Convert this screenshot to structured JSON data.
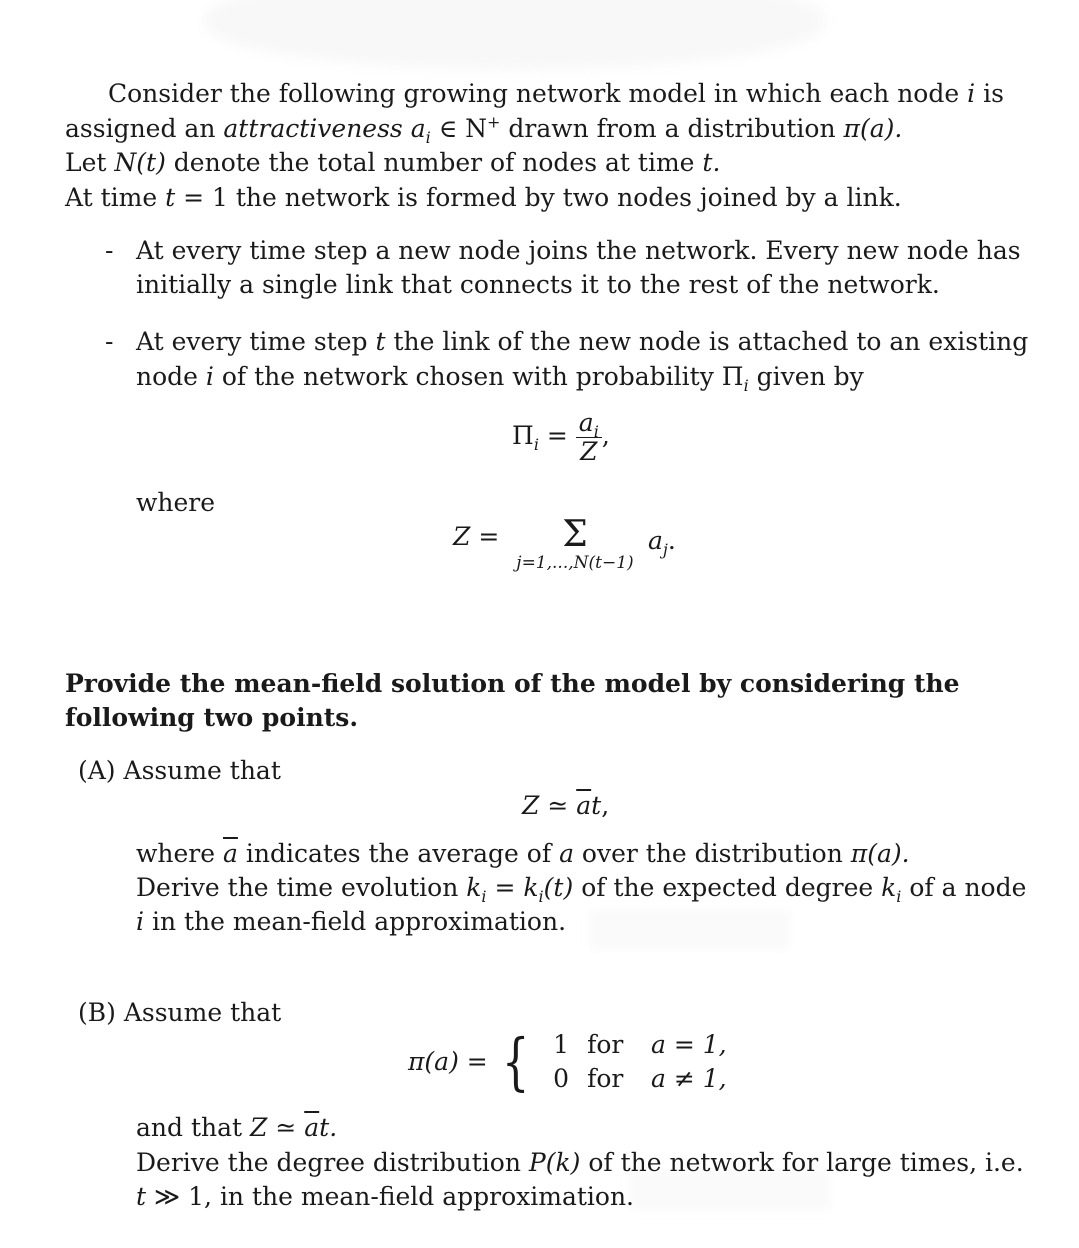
{
  "intro": {
    "line1": "Consider the following growing network model in which each node",
    "line1_var": "i",
    "line1_end": "is",
    "line2_start": "assigned an",
    "line2_em": "attractiveness",
    "line2_math": "a",
    "line2_math_sub": "i",
    "line2_in": "∈ N",
    "line2_sup": "+",
    "line2_end": "drawn from a distribution",
    "line2_pi": "π(a).",
    "line3_start": "Let",
    "line3_math": "N(t)",
    "line3_end": "denote the total number of nodes at time",
    "line3_t": "t.",
    "line4_start": "At time",
    "line4_math": "t",
    "line4_end": "= 1 the network is formed by two nodes joined by a link."
  },
  "bullets": [
    {
      "marker": "-",
      "line1": "At every time step a new node joins the network. Every new node has",
      "line2": "initially a single link that connects it to the rest of the network."
    },
    {
      "marker": "-",
      "line1_start": "At every time step",
      "line1_var": "t",
      "line1_end": "the link of the new node is attached to an existing",
      "line2_start": "node",
      "line2_var": "i",
      "line2_mid": "of the network chosen with probability Π",
      "line2_sub": "i",
      "line2_end": "given by"
    }
  ],
  "eq1": {
    "lhs": "Π",
    "lhs_sub": "i",
    "eq": "=",
    "num": "a",
    "num_sub": "i",
    "den": "Z",
    "trail": ","
  },
  "where_label": "where",
  "eq2": {
    "lhs": "Z",
    "eq": "=",
    "sigma": "Σ",
    "limits": "j=1,...,N(t−1)",
    "term": "a",
    "term_sub": "j",
    "trail": "."
  },
  "task": {
    "line1": "Provide the mean-field solution of the model by considering the",
    "line2": "following two points."
  },
  "partA": {
    "label": "(A)",
    "intro": "Assume that",
    "eq": {
      "lhs": "Z",
      "rel": "≃",
      "abar": "a",
      "t": "t",
      "trail": ","
    },
    "line1_start": "where",
    "line1_abar": "a",
    "line1_mid": "indicates the average of",
    "line1_a": "a",
    "line1_end": "over the distribution",
    "line1_pi": "π(a).",
    "line2_start": "Derive the time evolution",
    "line2_k": "k",
    "line2_k_sub": "i",
    "line2_eq": "=",
    "line2_kt": "k",
    "line2_kt_sub": "i",
    "line2_kt_arg": "(t)",
    "line2_mid": "of the expected degree",
    "line2_k2": "k",
    "line2_k2_sub": "i",
    "line2_end": "of a node",
    "line3_var": "i",
    "line3_end": "in the mean-field approximation."
  },
  "partB": {
    "label": "(B)",
    "intro": "Assume that",
    "eq": {
      "lhs": "π(a)",
      "eq": "=",
      "brace": "{",
      "cases": [
        {
          "value": "1",
          "word": "for",
          "cond": "a = 1,"
        },
        {
          "value": "0",
          "word": "for",
          "cond": "a ≠ 1,"
        }
      ]
    },
    "line1_start": "and that",
    "line1_Z": "Z",
    "line1_rel": "≃",
    "line1_abar": "a",
    "line1_t": "t.",
    "line2_start": "Derive the degree distribution",
    "line2_P": "P(k)",
    "line2_end": "of the network for large times, i.e.",
    "line3_t": "t",
    "line3_rel": "≫ 1,",
    "line3_end": "in the mean-field approximation."
  }
}
